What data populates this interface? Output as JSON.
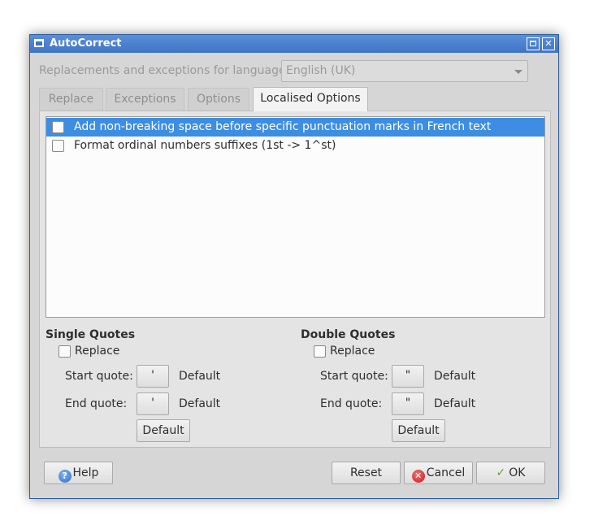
{
  "window": {
    "title": "AutoCorrect"
  },
  "language": {
    "label": "Replacements and exceptions for language:",
    "selected": "English (UK)"
  },
  "tabs": [
    {
      "label": "Replace"
    },
    {
      "label": "Exceptions"
    },
    {
      "label": "Options"
    },
    {
      "label": "Localised Options"
    }
  ],
  "list": [
    {
      "label": "Add non-breaking space before specific punctuation marks in French text"
    },
    {
      "label": "Format ordinal numbers suffixes (1st -> 1^st)"
    }
  ],
  "single_quotes": {
    "title": "Single Quotes",
    "replace_label": "Replace",
    "start_label": "Start quote:",
    "start_value": "'",
    "start_default": "Default",
    "end_label": "End quote:",
    "end_value": "'",
    "end_default": "Default",
    "default_button": "Default"
  },
  "double_quotes": {
    "title": "Double Quotes",
    "replace_label": "Replace",
    "start_label": "Start quote:",
    "start_value": "\"",
    "start_default": "Default",
    "end_label": "End quote:",
    "end_value": "\"",
    "end_default": "Default",
    "default_button": "Default"
  },
  "buttons": {
    "help": "Help",
    "reset": "Reset",
    "cancel": "Cancel",
    "ok": "OK"
  },
  "colors": {
    "selection": "#3d8ee2",
    "titlebar": "#3f74c4"
  }
}
